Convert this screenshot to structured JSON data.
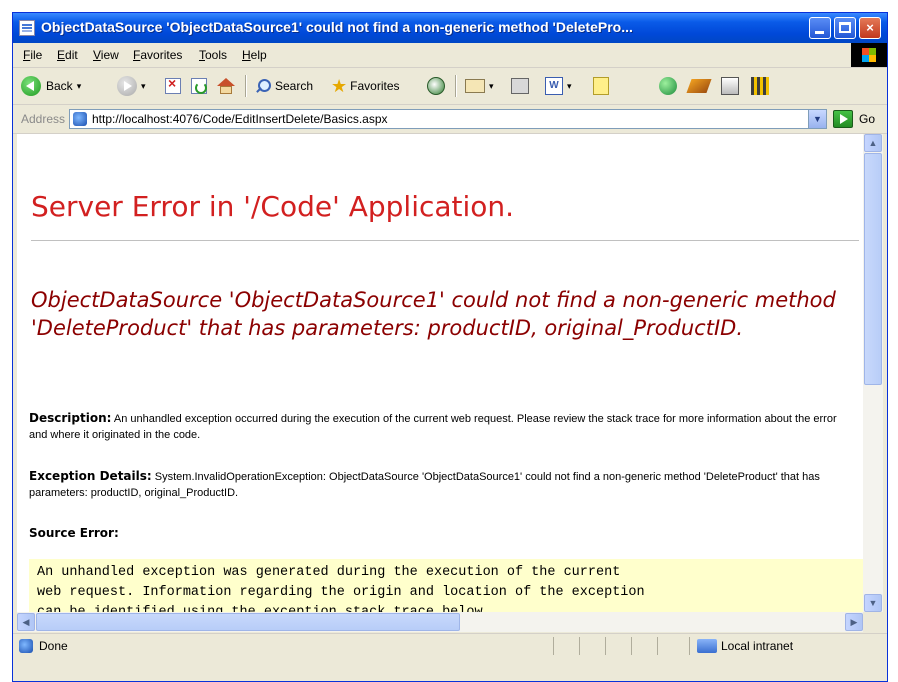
{
  "window": {
    "title": "ObjectDataSource 'ObjectDataSource1' could not find a non-generic method 'DeletePro...",
    "buttons": {
      "minimize": "",
      "maximize": "",
      "close": "×"
    }
  },
  "menubar": {
    "items": [
      "File",
      "Edit",
      "View",
      "Favorites",
      "Tools",
      "Help"
    ]
  },
  "toolbar": {
    "back_label": "Back",
    "search_label": "Search",
    "favorites_label": "Favorites",
    "caret": "▾",
    "word_icon_text": "W"
  },
  "addressbar": {
    "label": "Address",
    "url": "http://localhost:4076/Code/EditInsertDelete/Basics.aspx",
    "dropdown": "▼",
    "go_label": "Go"
  },
  "page": {
    "title": "Server Error in '/Code' Application.",
    "error_message": "ObjectDataSource 'ObjectDataSource1' could not find a non-generic method 'DeleteProduct' that has parameters: productID, original_ProductID.",
    "description_label": "Description:",
    "description_text": "An unhandled exception occurred during the execution of the current web request. Please review the stack trace for more information about the error and where it originated in the code.",
    "exception_label": "Exception Details:",
    "exception_text": "System.InvalidOperationException: ObjectDataSource 'ObjectDataSource1' could not find a non-generic method 'DeleteProduct' that has parameters: productID, original_ProductID.",
    "source_error_label": "Source Error:",
    "source_error_code": "An unhandled exception was generated during the execution of the current\nweb request. Information regarding the origin and location of the exception\ncan be identified using the exception stack trace below."
  },
  "scrollbars": {
    "up": "▲",
    "down": "▼",
    "left": "◀",
    "right": "▶"
  },
  "statusbar": {
    "status": "Done",
    "zone": "Local intranet"
  }
}
